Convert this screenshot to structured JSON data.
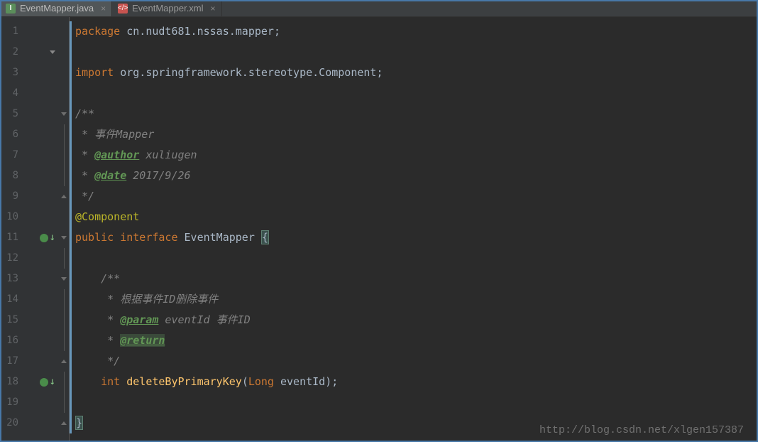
{
  "tabs": [
    {
      "label": "EventMapper.java",
      "icon": "I",
      "active": true
    },
    {
      "label": "EventMapper.xml",
      "icon": "</>",
      "active": false
    }
  ],
  "lines": {
    "count": 20
  },
  "code": {
    "l1_kw": "package",
    "l1_pkg": " cn.nudt681.nssas.mapper",
    "l1_semi": ";",
    "l3_kw": "import",
    "l3_pkg": " org.springframework.stereotype.",
    "l3_cls": "Component",
    "l3_semi": ";",
    "l5": "/**",
    "l6": " * 事件Mapper",
    "l7a": " * ",
    "l7tag": "@author",
    "l7b": " xuliugen",
    "l8a": " * ",
    "l8tag": "@date",
    "l8b": " 2017/9/26",
    "l9": " */",
    "l10": "@Component",
    "l11a": "public",
    "l11b": " interface",
    "l11c": " EventMapper ",
    "l11brace": "{",
    "l13": "    /**",
    "l14": "     * 根据事件ID删除事件",
    "l15a": "     * ",
    "l15tag": "@param",
    "l15b": " eventId 事件ID",
    "l16a": "     * ",
    "l16tag": "@return",
    "l17": "     */",
    "l18a": "    ",
    "l18kw": "int",
    "l18sp": " ",
    "l18m": "deleteByPrimaryKey",
    "l18p1": "(",
    "l18t": "Long",
    "l18p2": " eventId)",
    "l18semi": ";",
    "l20brace": "}"
  },
  "watermark": "http://blog.csdn.net/xlgen157387"
}
